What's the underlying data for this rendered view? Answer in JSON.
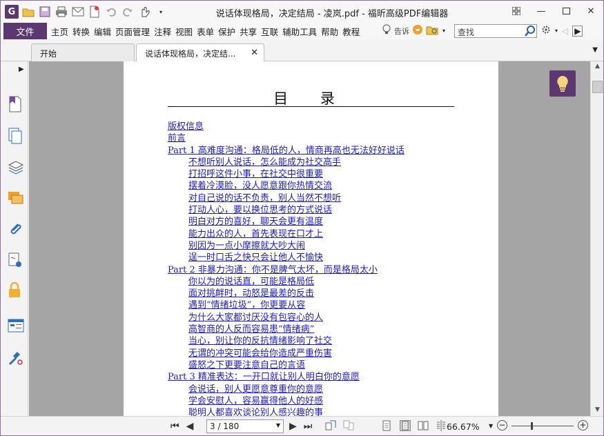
{
  "window": {
    "title": "说话体现格局，决定结局 - 凌岚.pdf - 福昕高级PDF编辑器"
  },
  "menu": {
    "file": "文件",
    "items": [
      "主页",
      "转换",
      "编辑",
      "页面管理",
      "注释",
      "视图",
      "表单",
      "保护",
      "共享",
      "互联",
      "辅助工具",
      "帮助",
      "教程"
    ],
    "tell": "告诉",
    "search_placeholder": "查找"
  },
  "tabs": [
    {
      "label": "开始"
    },
    {
      "label": "说话体现格局，决定结..."
    }
  ],
  "document": {
    "heading": "目 录",
    "toc": [
      {
        "text": "版权信息",
        "level": 1
      },
      {
        "text": "前言",
        "level": 1
      },
      {
        "text": "Part 1 高难度沟通：格局低的人，情商再高也无法好好说话",
        "level": 1
      },
      {
        "text": "不想听别人说话，怎么能成为社交高手",
        "level": 2
      },
      {
        "text": "打招呼这件小事，在社交中很重要",
        "level": 2
      },
      {
        "text": "摆着冷漠脸，没人愿意跟你热情交流",
        "level": 2
      },
      {
        "text": "对自己说的话不负责，别人当然不想听",
        "level": 2
      },
      {
        "text": "打动人心，要以换位思考的方式说话",
        "level": 2
      },
      {
        "text": "明白对方的喜好，聊天会更有温度",
        "level": 2
      },
      {
        "text": "能力出众的人，首先表现在口才上",
        "level": 2
      },
      {
        "text": "别因为一点小摩擦就大吵大闹",
        "level": 2
      },
      {
        "text": "逞一时口舌之快只会让他人不愉快",
        "level": 2
      },
      {
        "text": "Part 2 非暴力沟通：你不是脾气太坏，而是格局太小",
        "level": 1
      },
      {
        "text": "你以为的说话直，可能是格局低",
        "level": 2
      },
      {
        "text": "面对挑衅时，动怒是最差的反击",
        "level": 2
      },
      {
        "text": "遇到“情绪垃圾”，你更要从容",
        "level": 2
      },
      {
        "text": "为什么大家都讨厌没有包容心的人",
        "level": 2
      },
      {
        "text": "高智商的人反而容易患“情绪病”",
        "level": 2
      },
      {
        "text": "当心，别让你的反抗情绪影响了社交",
        "level": 2
      },
      {
        "text": "无谓的冲突可能会给你造成严重伤害",
        "level": 2
      },
      {
        "text": "盛怒之下更要注意自己的言语",
        "level": 2
      },
      {
        "text": "Part 3 精准表达：一开口就让别人明白你的意愿",
        "level": 1
      },
      {
        "text": "会说话，别人更愿意尊重你的意愿",
        "level": 2
      },
      {
        "text": "学会安慰人，容易赢得他人的好感",
        "level": 2
      },
      {
        "text": "聪明人都喜欢谈论别人感兴趣的事",
        "level": 2
      }
    ]
  },
  "status": {
    "page_display": "3 / 180",
    "zoom": "66.67%"
  },
  "colors": {
    "brand": "#5b3870",
    "link": "#1c1cc7",
    "canvas": "#a5a5a5"
  }
}
